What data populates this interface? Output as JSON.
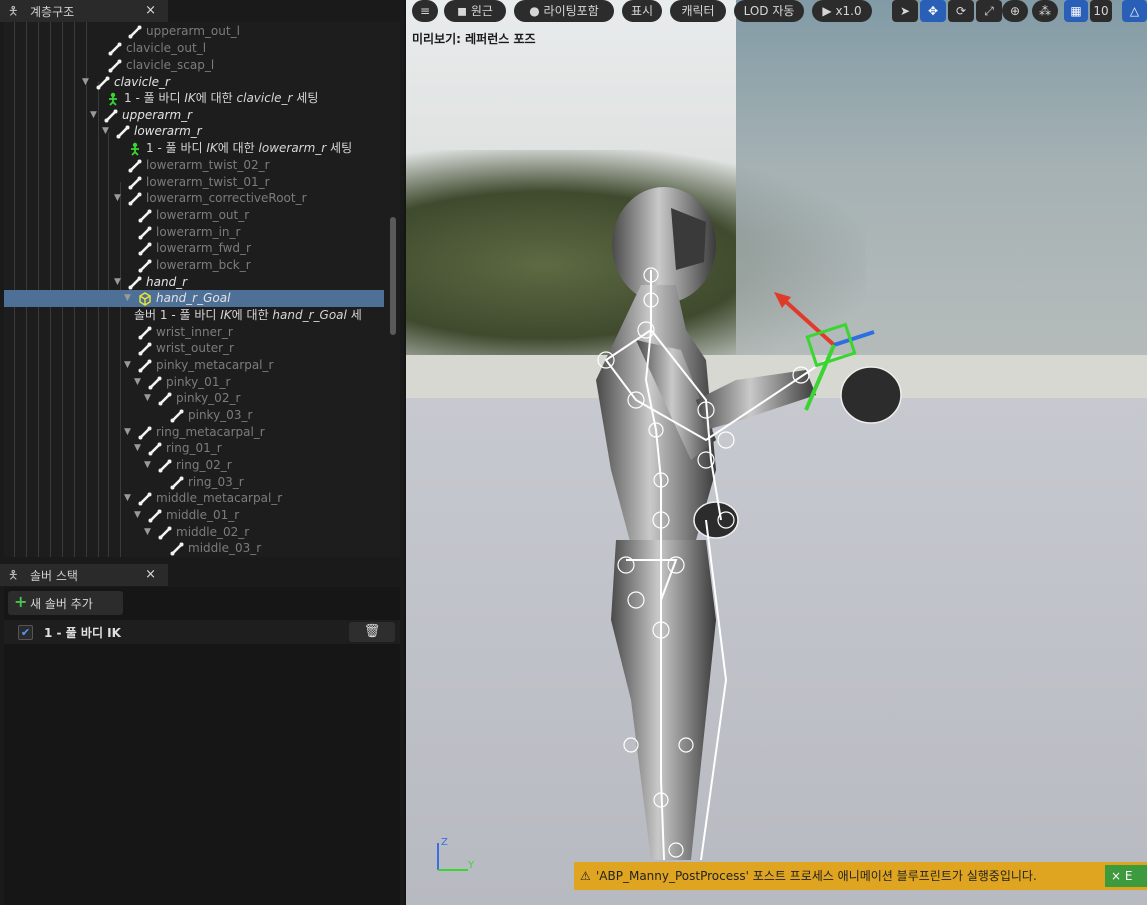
{
  "hierarchy_panel": {
    "title": "계층구조",
    "close_glyph": "×",
    "rows": [
      {
        "label": "upperarm_out_l",
        "style": "dim"
      },
      {
        "label": "clavicle_out_l",
        "style": "dim"
      },
      {
        "label": "clavicle_scap_l",
        "style": "dim"
      },
      {
        "label": "clavicle_r",
        "style": "bright"
      },
      {
        "label_pre": "1 - 풀 바디 ",
        "label_em": "IK",
        "label_mid": "에 대한 ",
        "label_em2": "clavicle_r",
        "label_post": " 세팅",
        "style": "note"
      },
      {
        "label": "upperarm_r",
        "style": "bright"
      },
      {
        "label": "lowerarm_r",
        "style": "bright"
      },
      {
        "label_pre": "1 - 풀 바디 ",
        "label_em": "IK",
        "label_mid": "에 대한 ",
        "label_em2": "lowerarm_r",
        "label_post": " 세팅",
        "style": "note"
      },
      {
        "label": "lowerarm_twist_02_r",
        "style": "dim"
      },
      {
        "label": "lowerarm_twist_01_r",
        "style": "dim"
      },
      {
        "label": "lowerarm_correctiveRoot_r",
        "style": "dim"
      },
      {
        "label": "lowerarm_out_r",
        "style": "dim"
      },
      {
        "label": "lowerarm_in_r",
        "style": "dim"
      },
      {
        "label": "lowerarm_fwd_r",
        "style": "dim"
      },
      {
        "label": "lowerarm_bck_r",
        "style": "dim"
      },
      {
        "label": "hand_r",
        "style": "bright"
      },
      {
        "label": "hand_r_Goal",
        "style": "bright"
      },
      {
        "label_pre": "솔버 1 - 풀 바디 ",
        "label_em": "IK",
        "label_mid": "에 대한 ",
        "label_em2": "hand_r_Goal",
        "label_post": " 세",
        "style": "note"
      },
      {
        "label": "wrist_inner_r",
        "style": "dim"
      },
      {
        "label": "wrist_outer_r",
        "style": "dim"
      },
      {
        "label": "pinky_metacarpal_r",
        "style": "dim"
      },
      {
        "label": "pinky_01_r",
        "style": "dim"
      },
      {
        "label": "pinky_02_r",
        "style": "dim"
      },
      {
        "label": "pinky_03_r",
        "style": "dim"
      },
      {
        "label": "ring_metacarpal_r",
        "style": "dim"
      },
      {
        "label": "ring_01_r",
        "style": "dim"
      },
      {
        "label": "ring_02_r",
        "style": "dim"
      },
      {
        "label": "ring_03_r",
        "style": "dim"
      },
      {
        "label": "middle_metacarpal_r",
        "style": "dim"
      },
      {
        "label": "middle_01_r",
        "style": "dim"
      },
      {
        "label": "middle_02_r",
        "style": "dim"
      },
      {
        "label": "middle_03_r",
        "style": "dim"
      }
    ]
  },
  "solver_panel": {
    "title": "솔버 스택",
    "close_glyph": "×",
    "add_button": "새 솔버 추가",
    "add_glyph": "+",
    "solvers": [
      {
        "name": "1 - 풀 바디 IK",
        "enabled": true,
        "check_glyph": "✔"
      }
    ],
    "delete_glyph": "🗑"
  },
  "viewport": {
    "toolbar": {
      "menu_glyph": "≡",
      "perspective": "원근",
      "lighting": "라이팅포함",
      "show": "표시",
      "character": "캐릭터",
      "lod": "LOD 자동",
      "play_speed": "x1.0",
      "play_glyph": "▶",
      "grid_count": "10"
    },
    "preview_label": "미리보기: 레퍼런스 포즈",
    "warning": {
      "text": "'ABP_Manny_PostProcess' 포스트 프로세스 애니메이션 블루프린트가 실행중입니다.",
      "glyph": "⚠",
      "action_glyph": "×",
      "action_label": "E"
    },
    "axis": {
      "z": "Z",
      "y": "Y"
    },
    "colors": {
      "active_tool": "#2a5fb8",
      "warning_bg": "#e0a520",
      "ik_goal": "#39d632",
      "selection": "#4e6f96"
    }
  }
}
